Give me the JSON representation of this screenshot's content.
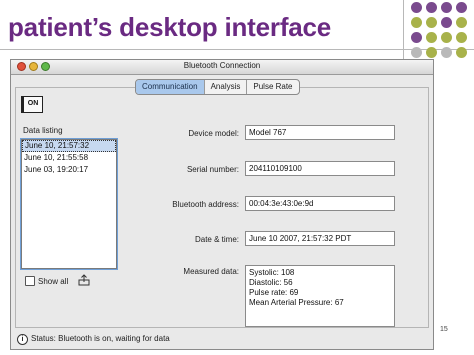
{
  "slide": {
    "title": "patient’s desktop interface",
    "page_number": "15",
    "dot_colors": [
      "#7a4a8e",
      "#a8b24a",
      "#b9b9b9"
    ]
  },
  "window": {
    "title": "Bluetooth Connection",
    "tabs": [
      {
        "label": "Communication",
        "active": true
      },
      {
        "label": "Analysis",
        "active": false
      },
      {
        "label": "Pulse Rate",
        "active": false
      }
    ],
    "power_button_label": "ON"
  },
  "data_listing": {
    "label": "Data listing",
    "items": [
      {
        "text": "June 10, 21:57:32",
        "selected": true
      },
      {
        "text": "June 10, 21:55:58",
        "selected": false
      },
      {
        "text": "June 03, 19:20:17",
        "selected": false
      }
    ],
    "show_all_label": "Show all",
    "show_all_checked": false
  },
  "fields": {
    "device_model": {
      "label": "Device model:",
      "value": "Model 767"
    },
    "serial_number": {
      "label": "Serial number:",
      "value": "204110109100"
    },
    "bluetooth_address": {
      "label": "Bluetooth address:",
      "value": "00:04:3e:43:0e:9d"
    },
    "date_time": {
      "label": "Date & time:",
      "value": "June 10 2007, 21:57:32 PDT"
    },
    "measured_data": {
      "label": "Measured data:",
      "lines": [
        "Systolic: 108",
        "Diastolic: 56",
        "Pulse rate: 69",
        "Mean Arterial Pressure: 67"
      ]
    }
  },
  "status": {
    "text": "Status: Bluetooth is on, waiting for data"
  }
}
